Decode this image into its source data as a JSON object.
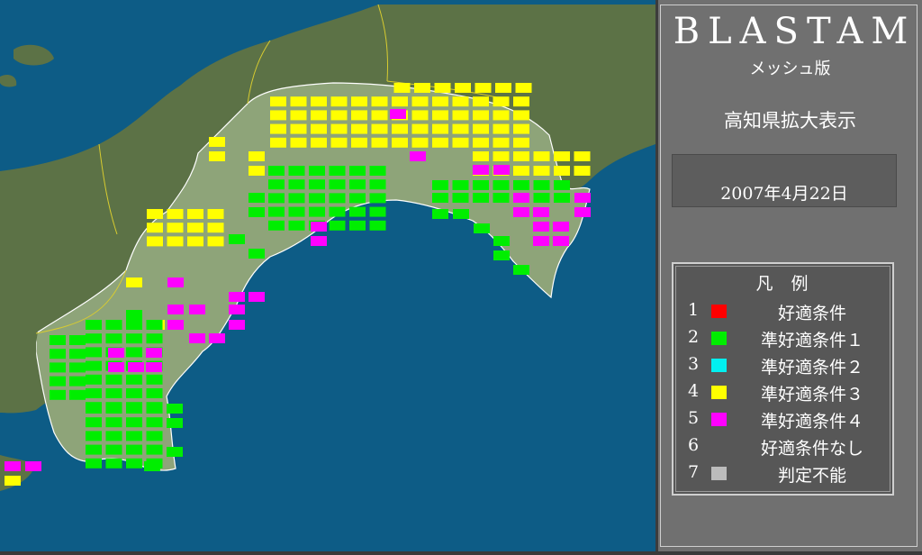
{
  "app": {
    "title": "BLASTAM",
    "subtitle": "メッシュ版"
  },
  "view_label": "高知県拡大表示",
  "date": "2007年4月22日",
  "legend": {
    "title": "凡例",
    "items": [
      {
        "num": "1",
        "label": "好適条件",
        "color": "#ff0000"
      },
      {
        "num": "2",
        "label": "準好適条件１",
        "color": "#00ee00"
      },
      {
        "num": "3",
        "label": "準好適条件２",
        "color": "#00f0f0"
      },
      {
        "num": "4",
        "label": "準好適条件３",
        "color": "#ffff00"
      },
      {
        "num": "5",
        "label": "準好適条件４",
        "color": "#ff00ff"
      },
      {
        "num": "6",
        "label": "好適条件なし",
        "color": ""
      },
      {
        "num": "7",
        "label": "判定不能",
        "color": "#bcbcbc"
      }
    ]
  },
  "map": {
    "colors": {
      "sea": "#0d5c86",
      "land": "#5c7246",
      "prefecture": "#8ea479",
      "boundary": "#d8cc30",
      "coast": "#ffffff"
    },
    "mesh_cells": [
      {
        "condition": 4,
        "count": 118
      },
      {
        "condition": 2,
        "count": 176
      },
      {
        "condition": 5,
        "count": 51
      }
    ]
  }
}
